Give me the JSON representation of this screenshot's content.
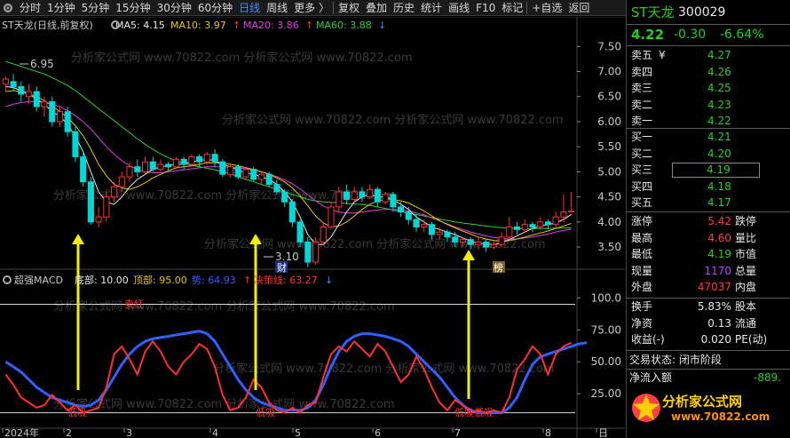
{
  "toolbar": {
    "items": [
      "分时",
      "1分钟",
      "5分钟",
      "15分钟",
      "30分钟",
      "60分钟",
      "日线",
      "周线",
      "更多 〉",
      "复权",
      "叠加",
      "历史",
      "统计",
      "画线",
      "F10",
      "标记",
      "+自选",
      "返回"
    ],
    "active_item": "日线"
  },
  "chart_header": {
    "title": "ST天龙(日线,前复权)",
    "ma5": "MA5: 4.15",
    "ma10": "MA10: 3.97",
    "ma20": "MA20: 3.86",
    "ma60": "MA60: 3.88",
    "ma5_color": "#e8e8e8",
    "ma10_color": "#e8c800",
    "ma20_color": "#e040e0",
    "ma60_color": "#30d030",
    "arrow_up": "↑",
    "arrow_down": "↓"
  },
  "annotations": {
    "high": "6.95",
    "low": "3.10",
    "cai_marker": "财",
    "bang_marker": "榜"
  },
  "indicator_header": {
    "title": "超强MACD",
    "bottom": "底部: 10.00",
    "top": "顶部: 95.00",
    "trend": "势: 64.93",
    "decision": "决策线: 63.27",
    "bottom_color": "#e8e8e8",
    "top_color": "#e8c800",
    "trend_color": "#3060ff",
    "decision_color": "#ff3030",
    "arrow_up": "↑",
    "arrow_down": "↓"
  },
  "indicator_labels": {
    "top_signal": "卖红",
    "low_signal": "低吸",
    "low_signal_b": "低吸",
    "low_signal_c": "低吸"
  },
  "watermarks": [
    "分析家公式网 www.70822.com 分析家公式网 www.70822.com"
  ],
  "price_axis": [
    "7.50",
    "7.00",
    "6.50",
    "6.00",
    "5.50",
    "5.00",
    "4.50",
    "4.00",
    "3.50"
  ],
  "indicator_axis": [
    "100.0",
    "75.00",
    "50.00",
    "25.00"
  ],
  "time_axis": [
    "2024年",
    "2",
    "3",
    "4",
    "5",
    "6",
    "7",
    "8",
    "日"
  ],
  "quote": {
    "name": "ST天龙",
    "code": "300029",
    "price": "4.22",
    "change": "-0.30",
    "change_pct": "-6.64%",
    "asks": [
      {
        "label": "卖五",
        "extra": "¥",
        "price": "4.27"
      },
      {
        "label": "卖四",
        "extra": "",
        "price": "4.26"
      },
      {
        "label": "卖三",
        "extra": "",
        "price": "4.25"
      },
      {
        "label": "卖二",
        "extra": "",
        "price": "4.23"
      },
      {
        "label": "卖一",
        "extra": "",
        "price": "4.22"
      }
    ],
    "bids": [
      {
        "label": "买一",
        "price": "4.21"
      },
      {
        "label": "买二",
        "price": "4.20"
      },
      {
        "label": "买三",
        "price": "4.19"
      },
      {
        "label": "买四",
        "price": "4.18"
      },
      {
        "label": "买五",
        "price": "4.17"
      }
    ],
    "stats": [
      {
        "l1": "涨停",
        "v1": "5.42",
        "l2": "跌停",
        "c": "red"
      },
      {
        "l1": "最高",
        "v1": "4.60",
        "l2": "量比",
        "c": "red"
      },
      {
        "l1": "最低",
        "v1": "4.19",
        "l2": "市值",
        "c": "green"
      },
      {
        "l1": "现量",
        "v1": "1170",
        "l2": "总量",
        "c": "purple"
      },
      {
        "l1": "外盘",
        "v1": "47037",
        "l2": "内盘",
        "c": "red"
      }
    ],
    "stats2": [
      {
        "l1": "换手",
        "v1": "5.83%",
        "l2": "股本"
      },
      {
        "l1": "净资",
        "v1": "0.13",
        "l2": "流通"
      },
      {
        "l1": "收益(-)",
        "v1": "0.020",
        "l2": "PE(动)"
      }
    ],
    "status": "交易状态: 闭市阶段",
    "netflow_label": "净流入额",
    "netflow_value": "-889.",
    "brand": "分析家公式网",
    "brand_url": "www.70822.com"
  },
  "chart_data": {
    "type": "candlestick",
    "price_range": [
      3.2,
      7.7
    ],
    "indicator_range": [
      0,
      110
    ],
    "indicator_levels": [
      95,
      10
    ],
    "candles": [
      [
        6.75,
        6.85,
        6.6,
        6.9
      ],
      [
        6.8,
        6.7,
        6.6,
        6.95
      ],
      [
        6.7,
        6.55,
        6.4,
        6.8
      ],
      [
        6.5,
        6.6,
        6.35,
        6.75
      ],
      [
        6.6,
        6.3,
        6.2,
        6.7
      ],
      [
        6.3,
        6.4,
        6.1,
        6.5
      ],
      [
        6.4,
        6.0,
        5.9,
        6.5
      ],
      [
        6.0,
        6.2,
        5.9,
        6.3
      ],
      [
        6.2,
        5.8,
        5.7,
        6.3
      ],
      [
        5.8,
        5.3,
        5.2,
        5.9
      ],
      [
        5.3,
        4.8,
        4.7,
        5.4
      ],
      [
        4.8,
        4.0,
        3.95,
        4.9
      ],
      [
        4.0,
        4.1,
        3.9,
        4.3
      ],
      [
        4.1,
        4.5,
        4.0,
        4.6
      ],
      [
        4.5,
        4.7,
        4.4,
        4.8
      ],
      [
        4.7,
        4.9,
        4.6,
        5.0
      ],
      [
        4.9,
        5.1,
        4.8,
        5.2
      ],
      [
        5.1,
        5.0,
        4.9,
        5.25
      ],
      [
        5.0,
        5.2,
        4.95,
        5.3
      ],
      [
        5.2,
        5.05,
        5.0,
        5.3
      ],
      [
        5.05,
        5.15,
        5.0,
        5.25
      ],
      [
        5.15,
        5.1,
        5.0,
        5.2
      ],
      [
        5.1,
        5.25,
        5.05,
        5.3
      ],
      [
        5.25,
        5.15,
        5.05,
        5.3
      ],
      [
        5.15,
        5.3,
        5.1,
        5.35
      ],
      [
        5.3,
        5.2,
        5.1,
        5.35
      ],
      [
        5.2,
        5.35,
        5.15,
        5.4
      ],
      [
        5.35,
        5.2,
        5.1,
        5.45
      ],
      [
        5.2,
        4.95,
        4.9,
        5.25
      ],
      [
        4.95,
        5.1,
        4.9,
        5.15
      ],
      [
        5.1,
        4.9,
        4.85,
        5.15
      ],
      [
        4.9,
        5.05,
        4.85,
        5.1
      ],
      [
        5.05,
        4.85,
        4.8,
        5.1
      ],
      [
        4.85,
        4.95,
        4.75,
        5.0
      ],
      [
        4.95,
        4.75,
        4.7,
        5.0
      ],
      [
        4.75,
        4.6,
        4.55,
        4.85
      ],
      [
        4.6,
        4.4,
        4.3,
        4.65
      ],
      [
        4.4,
        4.0,
        3.9,
        4.45
      ],
      [
        4.0,
        3.6,
        3.5,
        4.05
      ],
      [
        3.6,
        3.2,
        3.1,
        3.7
      ],
      [
        3.2,
        3.6,
        3.15,
        3.7
      ],
      [
        3.6,
        3.9,
        3.55,
        4.0
      ],
      [
        3.9,
        4.3,
        3.85,
        4.4
      ],
      [
        4.3,
        4.6,
        4.2,
        4.7
      ],
      [
        4.6,
        4.45,
        4.35,
        4.75
      ],
      [
        4.45,
        4.6,
        4.4,
        4.7
      ],
      [
        4.6,
        4.5,
        4.4,
        4.7
      ],
      [
        4.5,
        4.65,
        4.45,
        4.75
      ],
      [
        4.65,
        4.4,
        4.3,
        4.7
      ],
      [
        4.4,
        4.55,
        4.35,
        4.6
      ],
      [
        4.55,
        4.3,
        4.2,
        4.6
      ],
      [
        4.3,
        4.2,
        4.1,
        4.4
      ],
      [
        4.2,
        4.05,
        3.95,
        4.3
      ],
      [
        4.05,
        3.9,
        3.8,
        4.15
      ],
      [
        3.9,
        3.95,
        3.8,
        4.05
      ],
      [
        3.95,
        3.75,
        3.65,
        4.0
      ],
      [
        3.75,
        3.8,
        3.65,
        3.9
      ],
      [
        3.8,
        3.7,
        3.6,
        3.85
      ],
      [
        3.7,
        3.6,
        3.5,
        3.8
      ],
      [
        3.6,
        3.65,
        3.5,
        3.7
      ],
      [
        3.65,
        3.55,
        3.45,
        3.7
      ],
      [
        3.55,
        3.6,
        3.45,
        3.7
      ],
      [
        3.6,
        3.5,
        3.4,
        3.65
      ],
      [
        3.5,
        3.55,
        3.45,
        3.6
      ],
      [
        3.55,
        3.7,
        3.5,
        3.8
      ],
      [
        3.7,
        3.9,
        3.65,
        4.1
      ],
      [
        3.9,
        3.85,
        3.75,
        4.0
      ],
      [
        3.85,
        3.95,
        3.8,
        4.05
      ],
      [
        3.95,
        3.9,
        3.8,
        4.0
      ],
      [
        3.9,
        4.0,
        3.85,
        4.1
      ],
      [
        4.0,
        3.95,
        3.85,
        4.05
      ],
      [
        3.95,
        4.1,
        3.9,
        4.2
      ],
      [
        4.1,
        4.2,
        4.0,
        4.55
      ],
      [
        4.2,
        4.22,
        4.19,
        4.6
      ]
    ],
    "ma5": [
      6.7,
      6.68,
      6.62,
      6.55,
      6.45,
      6.35,
      6.2,
      6.1,
      5.95,
      5.7,
      5.4,
      5.0,
      4.6,
      4.4,
      4.35,
      4.5,
      4.7,
      4.85,
      4.95,
      5.05,
      5.1,
      5.12,
      5.15,
      5.15,
      5.2,
      5.22,
      5.25,
      5.22,
      5.15,
      5.1,
      5.03,
      4.98,
      4.95,
      4.9,
      4.85,
      4.75,
      4.6,
      4.4,
      4.1,
      3.75,
      3.55,
      3.55,
      3.7,
      3.95,
      4.2,
      4.4,
      4.5,
      4.55,
      4.5,
      4.5,
      4.45,
      4.35,
      4.25,
      4.1,
      4.0,
      3.9,
      3.85,
      3.8,
      3.75,
      3.68,
      3.62,
      3.58,
      3.56,
      3.55,
      3.58,
      3.65,
      3.72,
      3.8,
      3.87,
      3.92,
      3.95,
      3.98,
      4.05,
      4.15
    ],
    "ma10": [
      6.6,
      6.62,
      6.6,
      6.55,
      6.5,
      6.42,
      6.32,
      6.2,
      6.08,
      5.92,
      5.72,
      5.45,
      5.15,
      4.92,
      4.75,
      4.68,
      4.65,
      4.7,
      4.78,
      4.88,
      4.95,
      5.02,
      5.08,
      5.1,
      5.12,
      5.15,
      5.18,
      5.18,
      5.17,
      5.15,
      5.12,
      5.08,
      5.05,
      5.0,
      4.95,
      4.88,
      4.8,
      4.68,
      4.52,
      4.32,
      4.12,
      3.98,
      3.9,
      3.92,
      4.0,
      4.12,
      4.25,
      4.35,
      4.42,
      4.45,
      4.45,
      4.42,
      4.38,
      4.3,
      4.22,
      4.12,
      4.03,
      3.95,
      3.88,
      3.82,
      3.76,
      3.7,
      3.66,
      3.63,
      3.62,
      3.63,
      3.66,
      3.7,
      3.74,
      3.78,
      3.82,
      3.87,
      3.92,
      3.97
    ],
    "ma20": [
      6.3,
      6.35,
      6.38,
      6.4,
      6.4,
      6.38,
      6.35,
      6.3,
      6.22,
      6.12,
      6.0,
      5.85,
      5.68,
      5.5,
      5.35,
      5.22,
      5.12,
      5.05,
      5.0,
      4.98,
      4.98,
      5.0,
      5.02,
      5.04,
      5.06,
      5.08,
      5.1,
      5.1,
      5.1,
      5.09,
      5.08,
      5.06,
      5.04,
      5.0,
      4.96,
      4.9,
      4.84,
      4.76,
      4.66,
      4.54,
      4.42,
      4.32,
      4.25,
      4.2,
      4.18,
      4.18,
      4.2,
      4.22,
      4.24,
      4.25,
      4.25,
      4.24,
      4.22,
      4.18,
      4.14,
      4.08,
      4.02,
      3.96,
      3.9,
      3.85,
      3.8,
      3.76,
      3.72,
      3.69,
      3.67,
      3.66,
      3.66,
      3.68,
      3.7,
      3.73,
      3.76,
      3.8,
      3.83,
      3.86
    ],
    "ma60": [
      7.2,
      7.15,
      7.1,
      7.05,
      7.0,
      6.95,
      6.88,
      6.8,
      6.72,
      6.62,
      6.5,
      6.38,
      6.26,
      6.14,
      6.02,
      5.9,
      5.78,
      5.66,
      5.55,
      5.45,
      5.36,
      5.28,
      5.22,
      5.17,
      5.13,
      5.1,
      5.07,
      5.04,
      5.0,
      4.96,
      4.9,
      4.85,
      4.8,
      4.75,
      4.7,
      4.65,
      4.6,
      4.55,
      4.5,
      4.45,
      4.42,
      4.4,
      4.39,
      4.38,
      4.37,
      4.36,
      4.35,
      4.33,
      4.3,
      4.27,
      4.24,
      4.21,
      4.18,
      4.15,
      4.12,
      4.09,
      4.06,
      4.03,
      4.0,
      3.98,
      3.96,
      3.94,
      3.92,
      3.9,
      3.89,
      3.88,
      3.87,
      3.87,
      3.87,
      3.87,
      3.87,
      3.88,
      3.88,
      3.88
    ],
    "trend": [
      50,
      46,
      42,
      36,
      30,
      26,
      22,
      20,
      18,
      16,
      15,
      16,
      20,
      28,
      38,
      48,
      56,
      62,
      66,
      68,
      69,
      70,
      71,
      72,
      73,
      74,
      72,
      66,
      56,
      46,
      36,
      28,
      22,
      18,
      16,
      14,
      12,
      12,
      12,
      14,
      20,
      32,
      46,
      58,
      66,
      70,
      72,
      72,
      71,
      70,
      68,
      66,
      62,
      56,
      50,
      44,
      38,
      30,
      22,
      16,
      12,
      10,
      10,
      10,
      10,
      14,
      22,
      36,
      48,
      54,
      56,
      58,
      60,
      62,
      64,
      65
    ],
    "decision": [
      40,
      32,
      22,
      18,
      14,
      16,
      24,
      18,
      12,
      16,
      10,
      12,
      14,
      30,
      56,
      62,
      52,
      40,
      58,
      66,
      58,
      46,
      40,
      50,
      56,
      64,
      60,
      46,
      24,
      12,
      14,
      22,
      36,
      30,
      18,
      12,
      10,
      14,
      10,
      16,
      18,
      38,
      56,
      62,
      58,
      66,
      60,
      54,
      64,
      58,
      46,
      34,
      40,
      54,
      44,
      30,
      18,
      12,
      20,
      16,
      10,
      12,
      10,
      12,
      10,
      22,
      44,
      52,
      62,
      56,
      40,
      56,
      62,
      65
    ]
  }
}
